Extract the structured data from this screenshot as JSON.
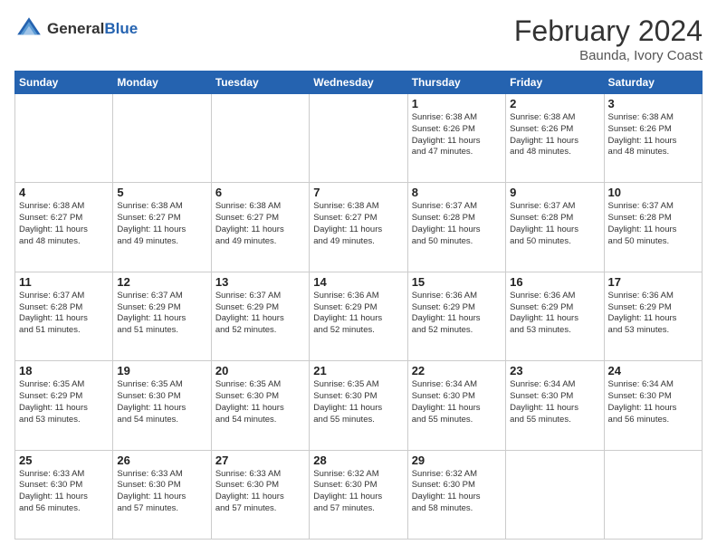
{
  "header": {
    "logo_general": "General",
    "logo_blue": "Blue",
    "month_year": "February 2024",
    "location": "Baunda, Ivory Coast"
  },
  "days_of_week": [
    "Sunday",
    "Monday",
    "Tuesday",
    "Wednesday",
    "Thursday",
    "Friday",
    "Saturday"
  ],
  "weeks": [
    [
      {
        "day": "",
        "info": ""
      },
      {
        "day": "",
        "info": ""
      },
      {
        "day": "",
        "info": ""
      },
      {
        "day": "",
        "info": ""
      },
      {
        "day": "1",
        "info": "Sunrise: 6:38 AM\nSunset: 6:26 PM\nDaylight: 11 hours\nand 47 minutes."
      },
      {
        "day": "2",
        "info": "Sunrise: 6:38 AM\nSunset: 6:26 PM\nDaylight: 11 hours\nand 48 minutes."
      },
      {
        "day": "3",
        "info": "Sunrise: 6:38 AM\nSunset: 6:26 PM\nDaylight: 11 hours\nand 48 minutes."
      }
    ],
    [
      {
        "day": "4",
        "info": "Sunrise: 6:38 AM\nSunset: 6:27 PM\nDaylight: 11 hours\nand 48 minutes."
      },
      {
        "day": "5",
        "info": "Sunrise: 6:38 AM\nSunset: 6:27 PM\nDaylight: 11 hours\nand 49 minutes."
      },
      {
        "day": "6",
        "info": "Sunrise: 6:38 AM\nSunset: 6:27 PM\nDaylight: 11 hours\nand 49 minutes."
      },
      {
        "day": "7",
        "info": "Sunrise: 6:38 AM\nSunset: 6:27 PM\nDaylight: 11 hours\nand 49 minutes."
      },
      {
        "day": "8",
        "info": "Sunrise: 6:37 AM\nSunset: 6:28 PM\nDaylight: 11 hours\nand 50 minutes."
      },
      {
        "day": "9",
        "info": "Sunrise: 6:37 AM\nSunset: 6:28 PM\nDaylight: 11 hours\nand 50 minutes."
      },
      {
        "day": "10",
        "info": "Sunrise: 6:37 AM\nSunset: 6:28 PM\nDaylight: 11 hours\nand 50 minutes."
      }
    ],
    [
      {
        "day": "11",
        "info": "Sunrise: 6:37 AM\nSunset: 6:28 PM\nDaylight: 11 hours\nand 51 minutes."
      },
      {
        "day": "12",
        "info": "Sunrise: 6:37 AM\nSunset: 6:29 PM\nDaylight: 11 hours\nand 51 minutes."
      },
      {
        "day": "13",
        "info": "Sunrise: 6:37 AM\nSunset: 6:29 PM\nDaylight: 11 hours\nand 52 minutes."
      },
      {
        "day": "14",
        "info": "Sunrise: 6:36 AM\nSunset: 6:29 PM\nDaylight: 11 hours\nand 52 minutes."
      },
      {
        "day": "15",
        "info": "Sunrise: 6:36 AM\nSunset: 6:29 PM\nDaylight: 11 hours\nand 52 minutes."
      },
      {
        "day": "16",
        "info": "Sunrise: 6:36 AM\nSunset: 6:29 PM\nDaylight: 11 hours\nand 53 minutes."
      },
      {
        "day": "17",
        "info": "Sunrise: 6:36 AM\nSunset: 6:29 PM\nDaylight: 11 hours\nand 53 minutes."
      }
    ],
    [
      {
        "day": "18",
        "info": "Sunrise: 6:35 AM\nSunset: 6:29 PM\nDaylight: 11 hours\nand 53 minutes."
      },
      {
        "day": "19",
        "info": "Sunrise: 6:35 AM\nSunset: 6:30 PM\nDaylight: 11 hours\nand 54 minutes."
      },
      {
        "day": "20",
        "info": "Sunrise: 6:35 AM\nSunset: 6:30 PM\nDaylight: 11 hours\nand 54 minutes."
      },
      {
        "day": "21",
        "info": "Sunrise: 6:35 AM\nSunset: 6:30 PM\nDaylight: 11 hours\nand 55 minutes."
      },
      {
        "day": "22",
        "info": "Sunrise: 6:34 AM\nSunset: 6:30 PM\nDaylight: 11 hours\nand 55 minutes."
      },
      {
        "day": "23",
        "info": "Sunrise: 6:34 AM\nSunset: 6:30 PM\nDaylight: 11 hours\nand 55 minutes."
      },
      {
        "day": "24",
        "info": "Sunrise: 6:34 AM\nSunset: 6:30 PM\nDaylight: 11 hours\nand 56 minutes."
      }
    ],
    [
      {
        "day": "25",
        "info": "Sunrise: 6:33 AM\nSunset: 6:30 PM\nDaylight: 11 hours\nand 56 minutes."
      },
      {
        "day": "26",
        "info": "Sunrise: 6:33 AM\nSunset: 6:30 PM\nDaylight: 11 hours\nand 57 minutes."
      },
      {
        "day": "27",
        "info": "Sunrise: 6:33 AM\nSunset: 6:30 PM\nDaylight: 11 hours\nand 57 minutes."
      },
      {
        "day": "28",
        "info": "Sunrise: 6:32 AM\nSunset: 6:30 PM\nDaylight: 11 hours\nand 57 minutes."
      },
      {
        "day": "29",
        "info": "Sunrise: 6:32 AM\nSunset: 6:30 PM\nDaylight: 11 hours\nand 58 minutes."
      },
      {
        "day": "",
        "info": ""
      },
      {
        "day": "",
        "info": ""
      }
    ]
  ]
}
